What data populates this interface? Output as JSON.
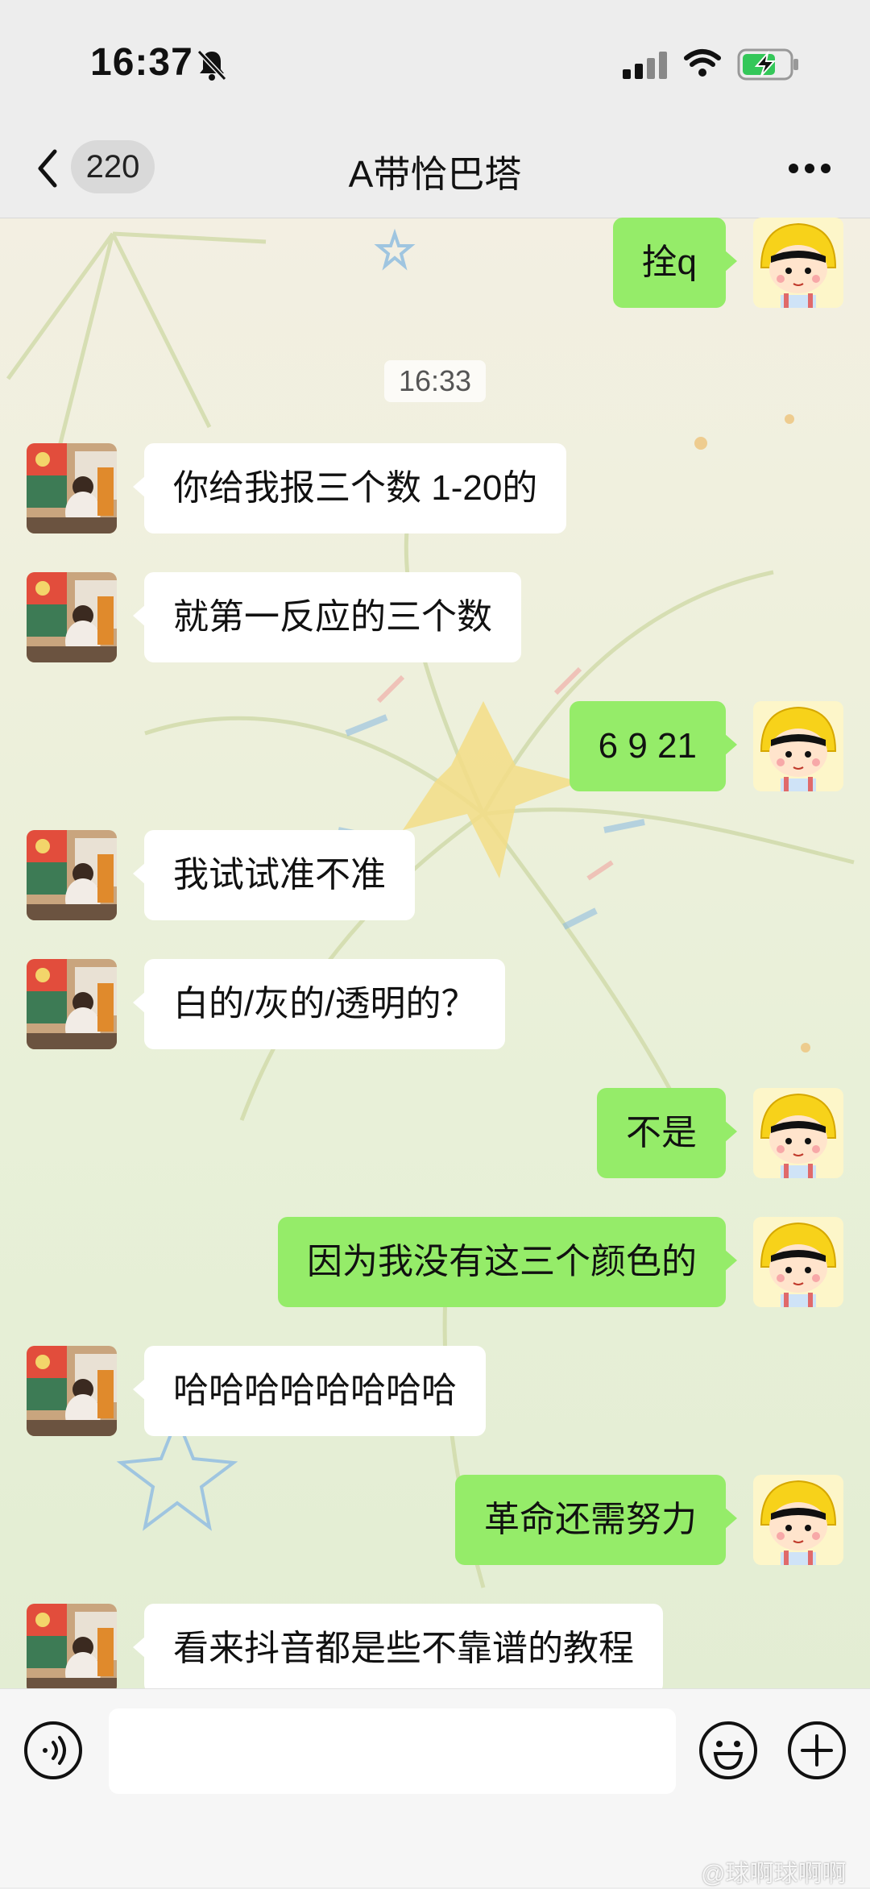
{
  "status_bar": {
    "time": "16:37"
  },
  "nav": {
    "unread_count": "220",
    "title": "A带恰巴塔"
  },
  "timestamp": "16:33",
  "messages": [
    {
      "sender": "self",
      "text": "拴q"
    },
    {
      "sender": "other",
      "text": "你给我报三个数 1-20的"
    },
    {
      "sender": "other",
      "text": "就第一反应的三个数"
    },
    {
      "sender": "self",
      "text": "6 9 21"
    },
    {
      "sender": "other",
      "text": "我试试准不准"
    },
    {
      "sender": "other",
      "text": "白的/灰的/透明的？"
    },
    {
      "sender": "self",
      "text": "不是"
    },
    {
      "sender": "self",
      "text": "因为我没有这三个颜色的"
    },
    {
      "sender": "other",
      "text": "哈哈哈哈哈哈哈哈"
    },
    {
      "sender": "self",
      "text": "革命还需努力"
    },
    {
      "sender": "other",
      "text": "看来抖音都是些不靠谱的教程"
    }
  ],
  "input_bar": {
    "placeholder": ""
  },
  "watermark": "@球啊球啊啊",
  "colors": {
    "self_bubble": "#95ec69",
    "other_bubble": "#ffffff",
    "background": "#ededed"
  },
  "icons": [
    "bell-slash-icon",
    "signal-icon",
    "wifi-icon",
    "battery-charging-icon",
    "back-icon",
    "more-icon",
    "voice-icon",
    "emoji-icon",
    "plus-icon"
  ]
}
